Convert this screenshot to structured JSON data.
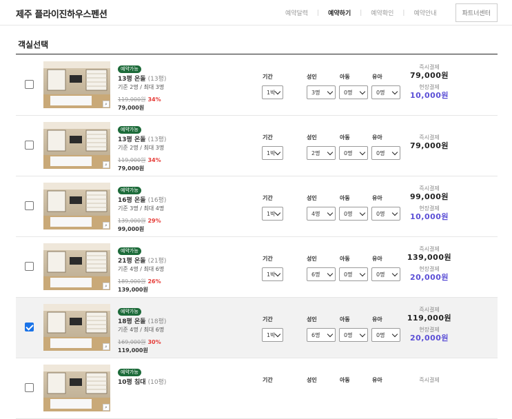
{
  "header": {
    "brand": "제주 플라이진하우스펜션",
    "nav": [
      "예약달력",
      "예약하기",
      "예약확인",
      "예약안내"
    ],
    "partner": "파트너센터"
  },
  "section_title": "객실선택",
  "labels": {
    "nights": "기간",
    "adult": "성인",
    "child": "아동",
    "infant": "유아"
  },
  "payment_labels": {
    "instant": "즉시결제",
    "onsite": "현장결제"
  },
  "rooms": [
    {
      "checked": false,
      "badge": "예약가능",
      "name": "13평 온돌",
      "pyeong": "(13평)",
      "capacity": "기준 2명 / 최대 3명",
      "original": "119,000원",
      "discount": "34%",
      "price": "79,000원",
      "nights": "1박",
      "adult": "3명",
      "child": "0명",
      "infant": "0명",
      "instant": "79,000원",
      "onsite": "10,000원"
    },
    {
      "checked": false,
      "badge": "예약가능",
      "name": "13평 온돌",
      "pyeong": "(13평)",
      "capacity": "기준 2명 / 최대 3명",
      "original": "119,000원",
      "discount": "34%",
      "price": "79,000원",
      "nights": "1박",
      "adult": "2명",
      "child": "0명",
      "infant": "0명",
      "instant": "79,000원",
      "onsite": ""
    },
    {
      "checked": false,
      "badge": "예약가능",
      "name": "16평 온돌",
      "pyeong": "(16평)",
      "capacity": "기준 3명 / 최대 4명",
      "original": "139,000원",
      "discount": "29%",
      "price": "99,000원",
      "nights": "1박",
      "adult": "4명",
      "child": "0명",
      "infant": "0명",
      "instant": "99,000원",
      "onsite": "10,000원"
    },
    {
      "checked": false,
      "badge": "예약가능",
      "name": "21평 온돌",
      "pyeong": "(21평)",
      "capacity": "기준 4명 / 최대 6명",
      "original": "189,000원",
      "discount": "26%",
      "price": "139,000원",
      "nights": "1박",
      "adult": "6명",
      "child": "0명",
      "infant": "0명",
      "instant": "139,000원",
      "onsite": "20,000원"
    },
    {
      "checked": true,
      "badge": "예약가능",
      "name": "18평 온돌",
      "pyeong": "(18평)",
      "capacity": "기준 4명 / 최대 6명",
      "original": "169,000원",
      "discount": "30%",
      "price": "119,000원",
      "nights": "1박",
      "adult": "6명",
      "child": "0명",
      "infant": "0명",
      "instant": "119,000원",
      "onsite": "20,000원"
    },
    {
      "checked": false,
      "badge": "예약가능",
      "name": "10평 침대",
      "pyeong": "(10평)",
      "capacity": "",
      "original": "",
      "discount": "",
      "price": "",
      "nights": "",
      "adult": "",
      "child": "",
      "infant": "",
      "instant": "",
      "onsite": ""
    }
  ],
  "colors": {
    "badge": "#1d6b3a",
    "discount": "#e53935",
    "onsite": "#5b4fd6",
    "checkbox": "#1a73e8"
  }
}
